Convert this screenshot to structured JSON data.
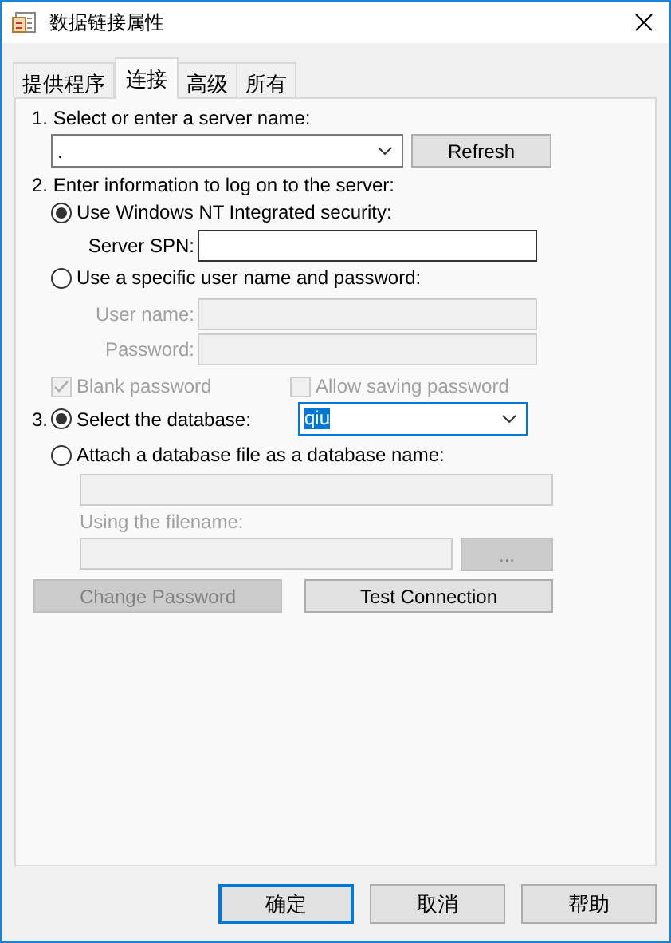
{
  "window": {
    "title": "数据链接属性"
  },
  "tabs": [
    {
      "label": "提供程序",
      "selected": false
    },
    {
      "label": "连接",
      "selected": true
    },
    {
      "label": "高级",
      "selected": false
    },
    {
      "label": "所有",
      "selected": false
    }
  ],
  "server": {
    "label": "1. Select or enter a server name:",
    "value": ".",
    "button": "Refresh"
  },
  "logon": {
    "label": "2. Enter information to log on to the server:",
    "options": [
      {
        "label": "Use Windows NT Integrated security:",
        "selected": true,
        "fields": [
          {
            "label": "Server SPN:",
            "disabled": false
          }
        ]
      },
      {
        "label": "Use a specific user name and password:",
        "selected": false,
        "fields": [
          {
            "label": "User name:",
            "disabled": true
          },
          {
            "label": "Password:",
            "disabled": true
          }
        ]
      }
    ],
    "checkboxes": [
      {
        "label": "Blank password",
        "checked": true,
        "disabled": true
      },
      {
        "label": "Allow saving password",
        "checked": false,
        "disabled": true
      }
    ]
  },
  "database": {
    "number": "3.",
    "select_option": {
      "label": "Select the database:",
      "selected": true,
      "value": "qiu",
      "text_selected": true
    },
    "attach_option": {
      "label": "Attach a database file as a database name:",
      "selected": false,
      "disabled": true,
      "filename_label": "Using the filename:",
      "browse": "..."
    }
  },
  "actions": [
    {
      "label": "Change Password",
      "disabled": true
    },
    {
      "label": "Test Connection",
      "disabled": false
    }
  ],
  "buttons": [
    {
      "label": "确定",
      "default": true
    },
    {
      "label": "取消",
      "default": false
    },
    {
      "label": "帮助",
      "default": false
    }
  ]
}
